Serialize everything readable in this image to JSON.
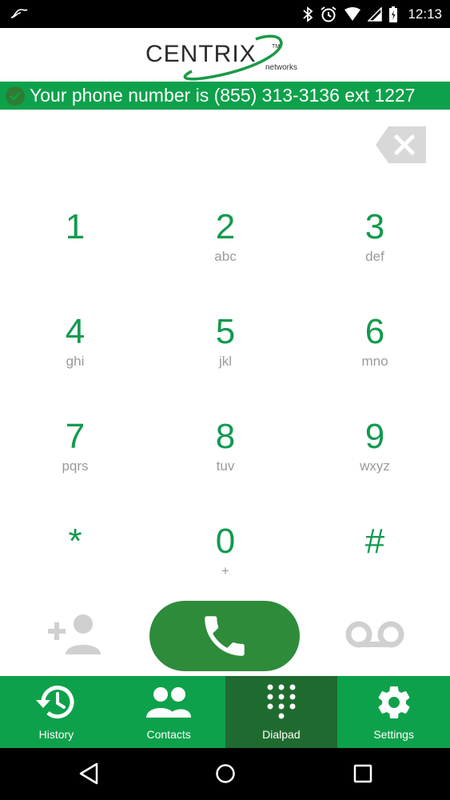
{
  "status_bar": {
    "time": "12:13",
    "icons": [
      "notification-icon",
      "bluetooth-icon",
      "alarm-icon",
      "wifi-icon",
      "cellular-icon",
      "battery-icon"
    ]
  },
  "header": {
    "logo_text": "CENTRIX",
    "logo_tm": "TM",
    "logo_sub": "networks"
  },
  "banner": {
    "message": "Your phone number is (855) 313-3136 ext 1227"
  },
  "keypad": {
    "keys": [
      {
        "digit": "1",
        "letters": ""
      },
      {
        "digit": "2",
        "letters": "abc"
      },
      {
        "digit": "3",
        "letters": "def"
      },
      {
        "digit": "4",
        "letters": "ghi"
      },
      {
        "digit": "5",
        "letters": "jkl"
      },
      {
        "digit": "6",
        "letters": "mno"
      },
      {
        "digit": "7",
        "letters": "pqrs"
      },
      {
        "digit": "8",
        "letters": "tuv"
      },
      {
        "digit": "9",
        "letters": "wxyz"
      },
      {
        "digit": "*",
        "letters": ""
      },
      {
        "digit": "0",
        "letters": "+"
      },
      {
        "digit": "#",
        "letters": ""
      }
    ]
  },
  "tabs": {
    "history": "History",
    "contacts": "Contacts",
    "dialpad": "Dialpad",
    "settings": "Settings",
    "active": "Dialpad"
  },
  "colors": {
    "accent_green": "#0ea14b",
    "digit_green": "#129a4e",
    "call_green": "#2e8b3a",
    "active_tab": "#1f6b2f",
    "letters_gray": "#9a9a9a"
  }
}
